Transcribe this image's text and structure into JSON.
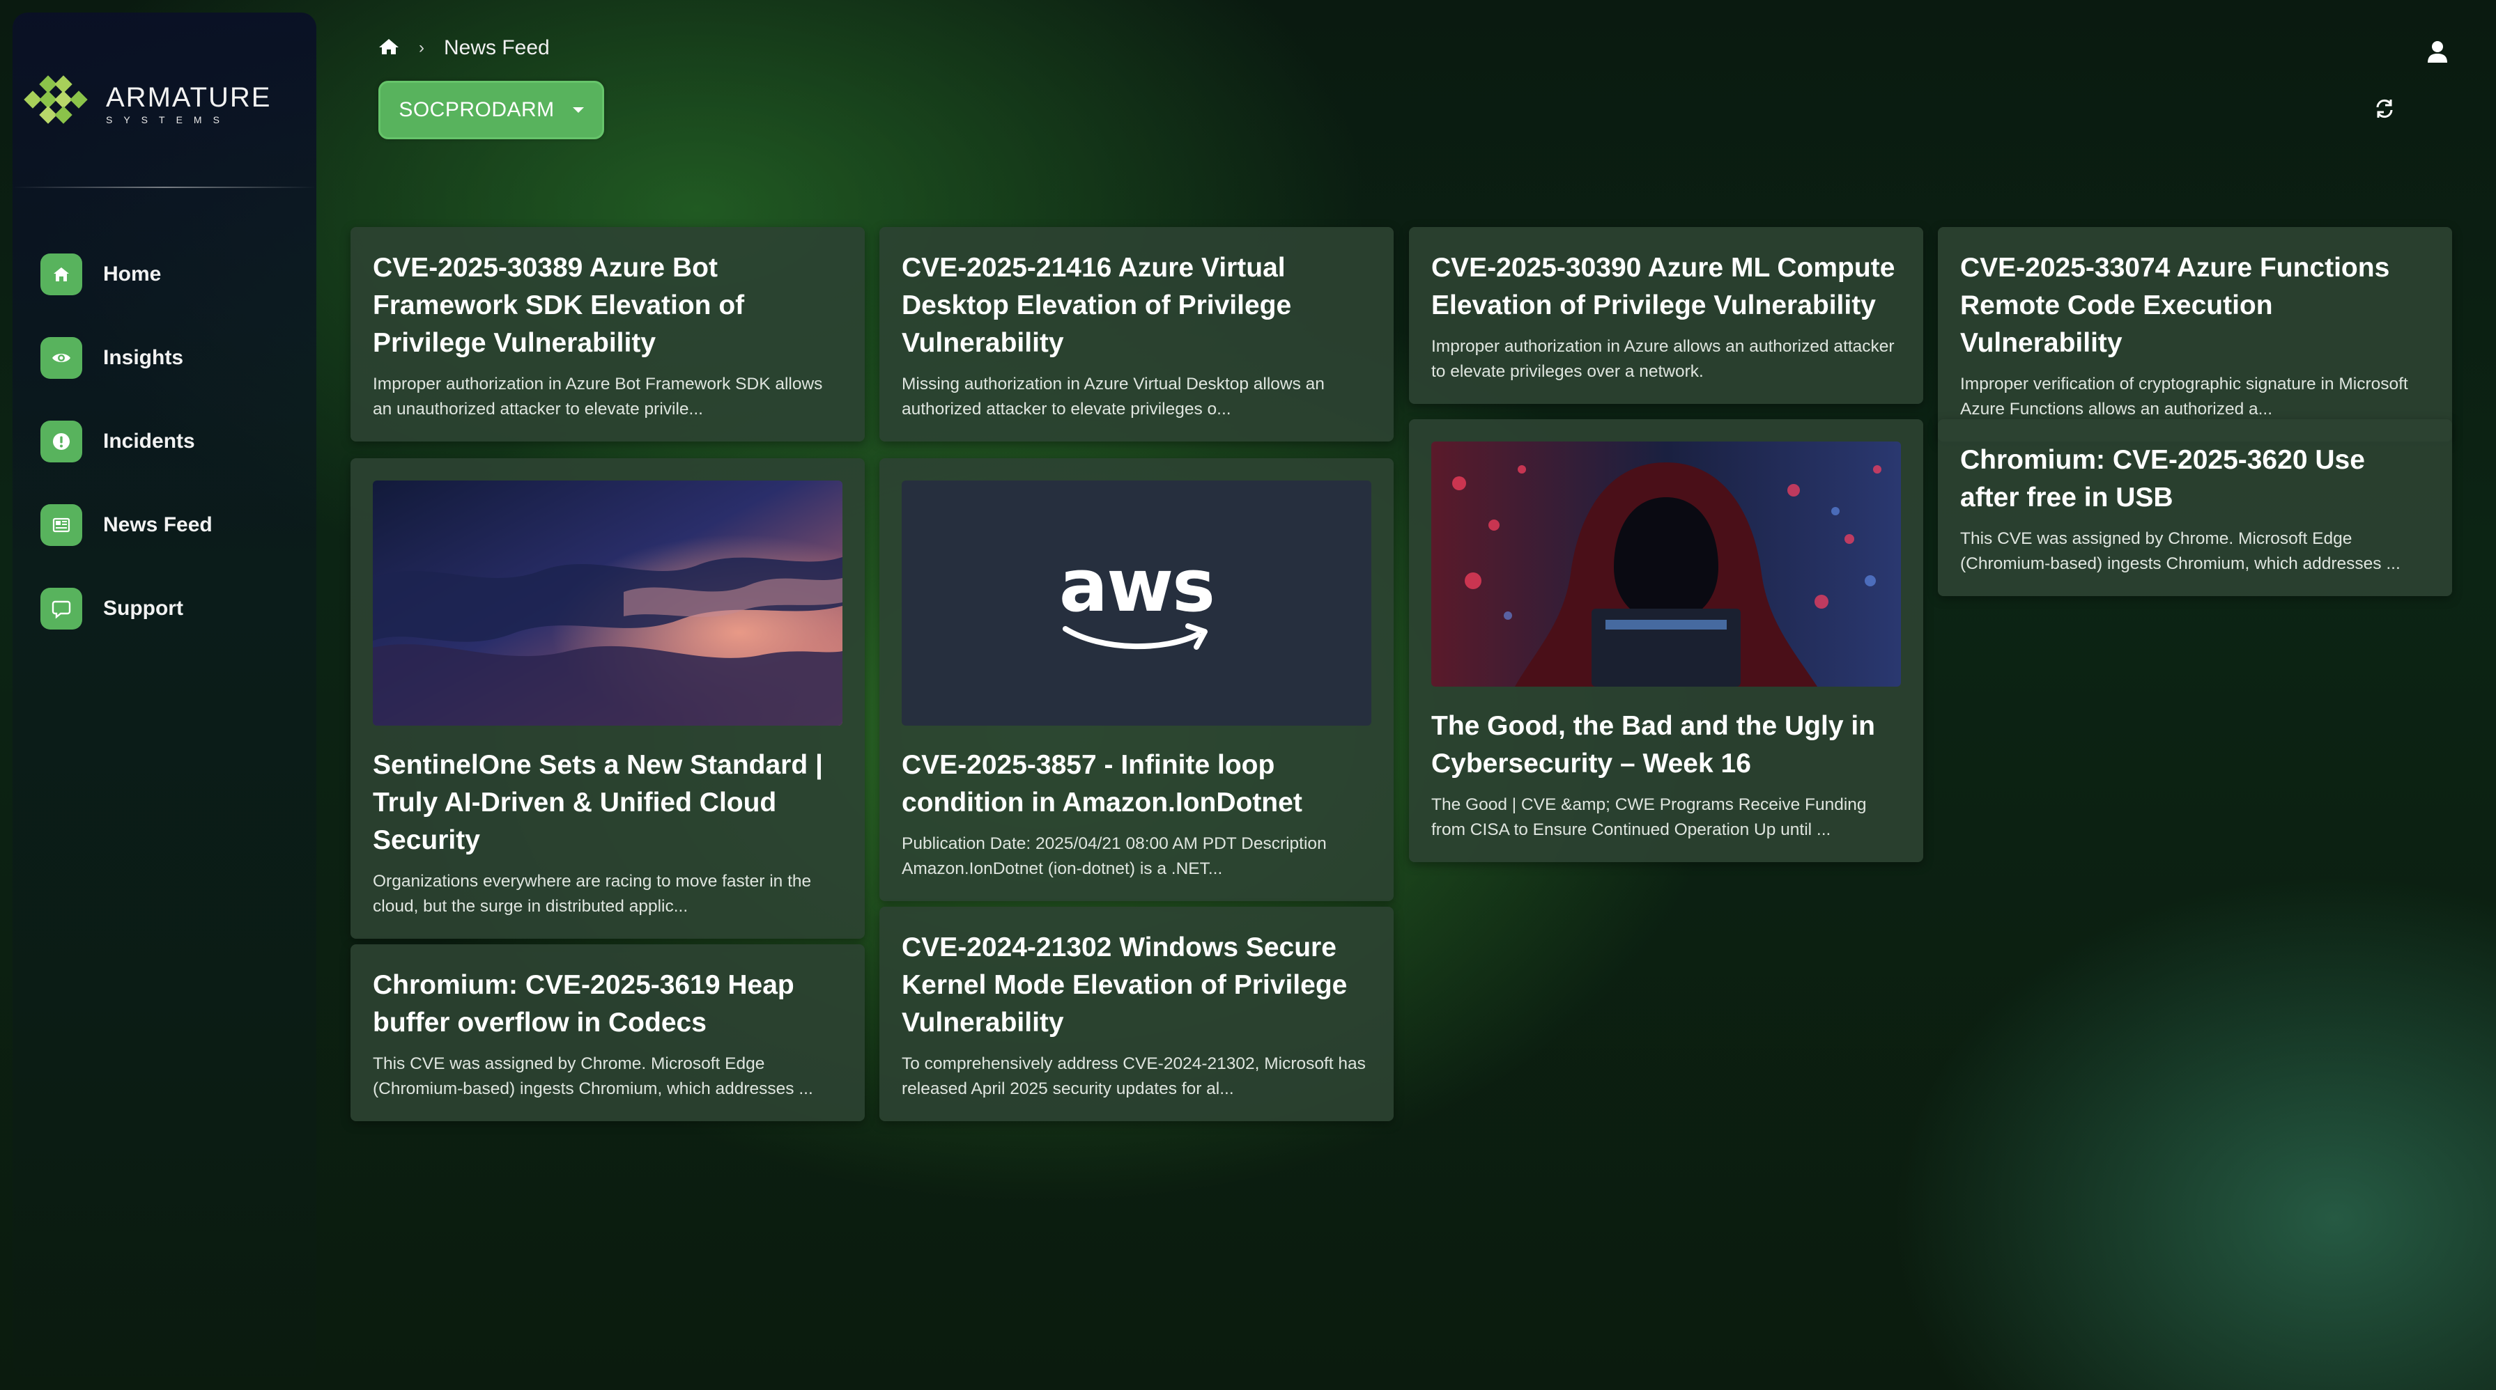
{
  "app": {
    "brand_main": "ARMATURE",
    "brand_sub": "SYSTEMS",
    "accent_color": "#58b35d"
  },
  "sidebar": {
    "items": [
      {
        "label": "Home",
        "icon": "home-icon"
      },
      {
        "label": "Insights",
        "icon": "eye-icon"
      },
      {
        "label": "Incidents",
        "icon": "alert-icon"
      },
      {
        "label": "News Feed",
        "icon": "newspaper-icon"
      },
      {
        "label": "Support",
        "icon": "chat-icon"
      }
    ]
  },
  "header": {
    "breadcrumb_icon": "home-icon",
    "breadcrumb_separator": "›",
    "breadcrumb_current": "News Feed",
    "tenant_selector": "SOCPRODARM"
  },
  "cards": [
    {
      "title": "CVE-2025-30389 Azure Bot Framework SDK Elevation of Privilege Vulnerability",
      "description": "Improper authorization in Azure Bot Framework SDK allows an unauthorized attacker to elevate privile..."
    },
    {
      "title": "SentinelOne Sets a New Standard | Truly AI-Driven & Unified Cloud Security",
      "description": "Organizations everywhere are racing to move faster in the cloud, but the surge in distributed applic...",
      "image": "cloud-sunset-image"
    },
    {
      "title": "Chromium: CVE-2025-3619 Heap buffer overflow in Codecs",
      "description": "This CVE was assigned by Chrome. Microsoft Edge (Chromium-based) ingests Chromium, which addresses ..."
    },
    {
      "title": "CVE-2025-21416 Azure Virtual Desktop Elevation of Privilege Vulnerability",
      "description": "Missing authorization in Azure Virtual Desktop allows an authorized attacker to elevate privileges o..."
    },
    {
      "title": "CVE-2025-3857 - Infinite loop condition in Amazon.IonDotnet",
      "description": "Publication Date: 2025/04/21 08:00 AM PDT Description Amazon.IonDotnet (ion-dotnet) is a .NET...",
      "image": "aws-logo-image",
      "image_text": "aws"
    },
    {
      "title": "CVE-2024-21302 Windows Secure Kernel Mode Elevation of Privilege Vulnerability",
      "description": "To comprehensively address CVE-2024-21302, Microsoft has released April 2025 security updates for al..."
    },
    {
      "title": "CVE-2025-30390 Azure ML Compute Elevation of Privilege Vulnerability",
      "description": "Improper authorization in Azure allows an authorized attacker to elevate privileges over a network."
    },
    {
      "title": "The Good, the Bad and the Ugly in Cybersecurity – Week 16",
      "description": "The Good | CVE &amp; CWE Programs Receive Funding from CISA to Ensure Continued Operation Up until ...",
      "image": "hooded-hacker-image"
    },
    {
      "title": "CVE-2025-33074 Azure Functions Remote Code Execution Vulnerability",
      "description": "Improper verification of cryptographic signature in Microsoft Azure Functions allows an authorized a..."
    },
    {
      "title": "Chromium: CVE-2025-3620 Use after free in USB",
      "description": "This CVE was assigned by Chrome. Microsoft Edge (Chromium-based) ingests Chromium, which addresses ..."
    }
  ]
}
